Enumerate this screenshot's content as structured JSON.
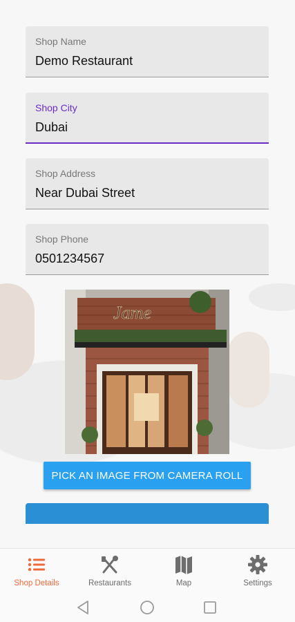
{
  "form": {
    "shop_name": {
      "label": "Shop Name",
      "value": "Demo Restaurant"
    },
    "shop_city": {
      "label": "Shop City",
      "value": "Dubai"
    },
    "shop_address": {
      "label": "Shop Address",
      "value": "Near Dubai Street"
    },
    "shop_phone": {
      "label": "Shop Phone",
      "value": "0501234567"
    }
  },
  "image_sign": "Jame",
  "pick_image_label": "PICK AN IMAGE FROM CAMERA ROLL",
  "tabs": [
    {
      "label": "Shop Details",
      "icon": "list-icon",
      "active": true
    },
    {
      "label": "Restaurants",
      "icon": "cutlery-icon",
      "active": false
    },
    {
      "label": "Map",
      "icon": "map-icon",
      "active": false
    },
    {
      "label": "Settings",
      "icon": "gear-icon",
      "active": false
    }
  ],
  "colors": {
    "accent": "#6a2cc9",
    "button": "#2aa1f0",
    "active_tab": "#ef6a3b"
  }
}
